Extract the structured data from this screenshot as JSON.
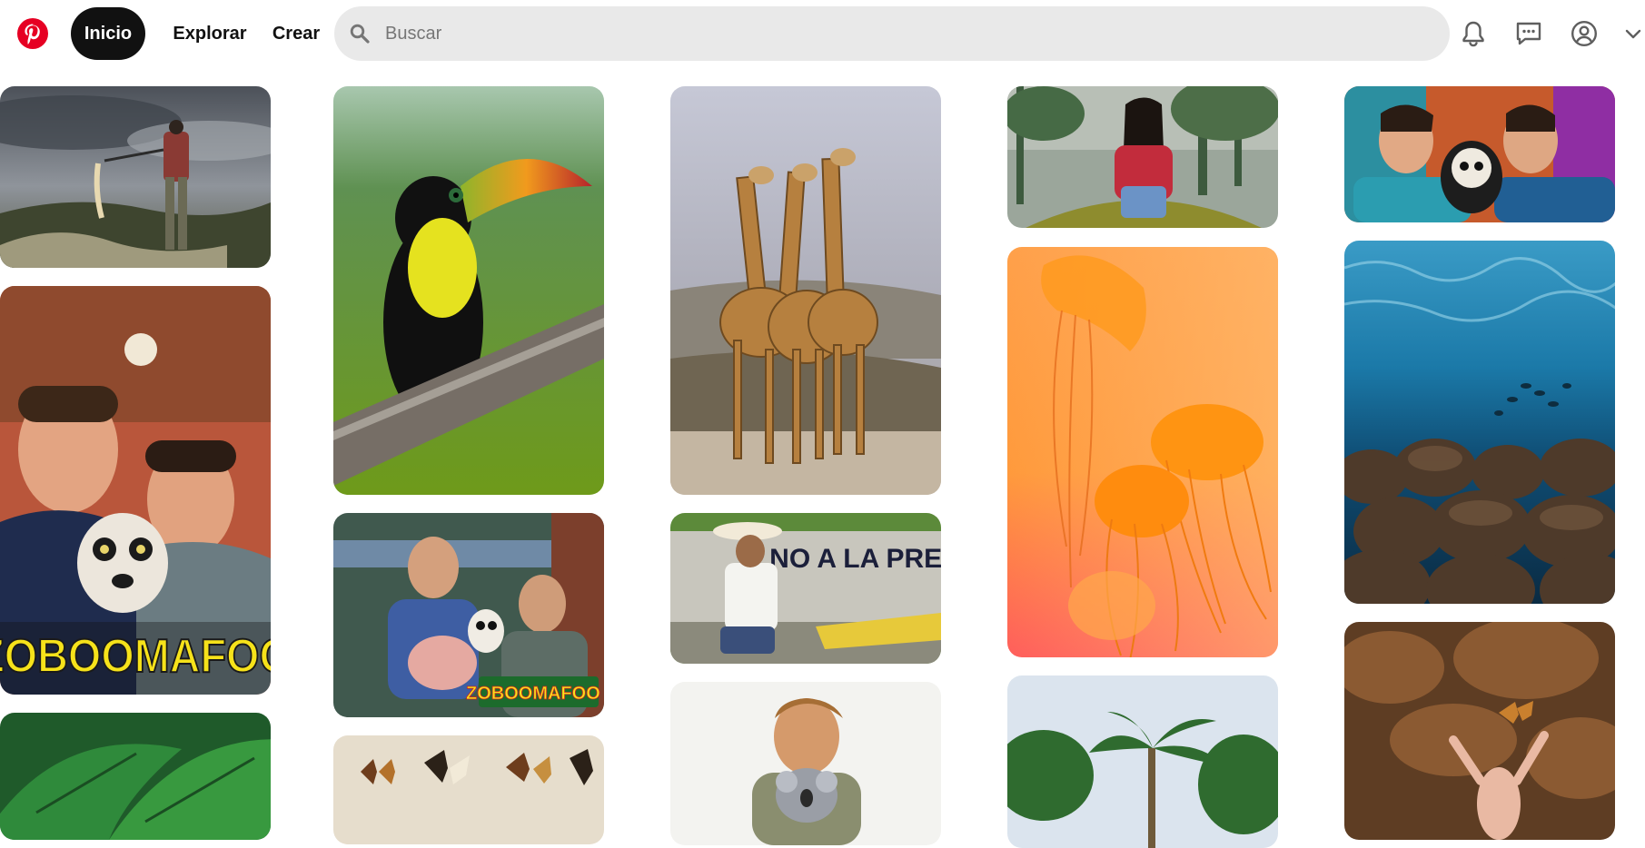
{
  "header": {
    "nav": {
      "home": "Inicio",
      "explore": "Explorar",
      "create": "Crear"
    },
    "search": {
      "placeholder": "Buscar"
    },
    "brand_color": "#e60023"
  },
  "pins": {
    "zoboomafoo_poster_text": "ZOBOOMAFOO",
    "zoboomafoo_small_text": "ZOBOOMAFOO !",
    "protest_sign_text": "NO A LA PRESA"
  }
}
